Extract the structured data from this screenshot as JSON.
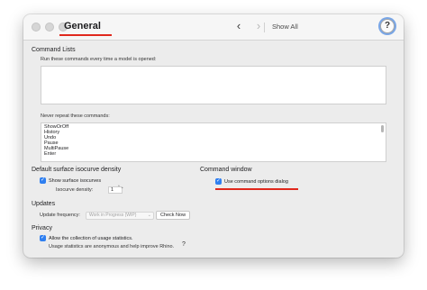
{
  "titlebar": {
    "title": "General",
    "back_glyph": "‹",
    "forward_glyph": "›",
    "show_all": "Show All",
    "help_glyph": "?",
    "accent_color": "#e0281d"
  },
  "command_lists": {
    "section_title": "Command Lists",
    "run_label": "Run these commands every time a model is opened:",
    "run_value": "",
    "never_repeat_label": "Never repeat these commands:",
    "never_repeat_items": [
      "ShowOrOff",
      "History",
      "Undo",
      "Pause",
      "MultiPause",
      "Enter"
    ]
  },
  "isocurve": {
    "section_title": "Default surface isocurve density",
    "show_label": "Show surface isocurves",
    "show_checked": true,
    "density_label": "Isocurve density:",
    "density_value": "1",
    "stepper_glyph": "⌃⌄"
  },
  "command_window": {
    "section_title": "Command window",
    "use_options_label": "Use command options dialog",
    "use_options_checked": true
  },
  "updates": {
    "section_title": "Updates",
    "frequency_label": "Update frequency:",
    "frequency_value": "Work in Progress (WIP)",
    "select_arrow": "⌄",
    "check_now_label": "Check Now"
  },
  "privacy": {
    "section_title": "Privacy",
    "allow_label": "Allow the collection of usage statistics.",
    "allow_checked": true,
    "note": "Usage statistics are anonymous and help improve Rhino.",
    "help_glyph": "?"
  },
  "checkmark": "✓"
}
